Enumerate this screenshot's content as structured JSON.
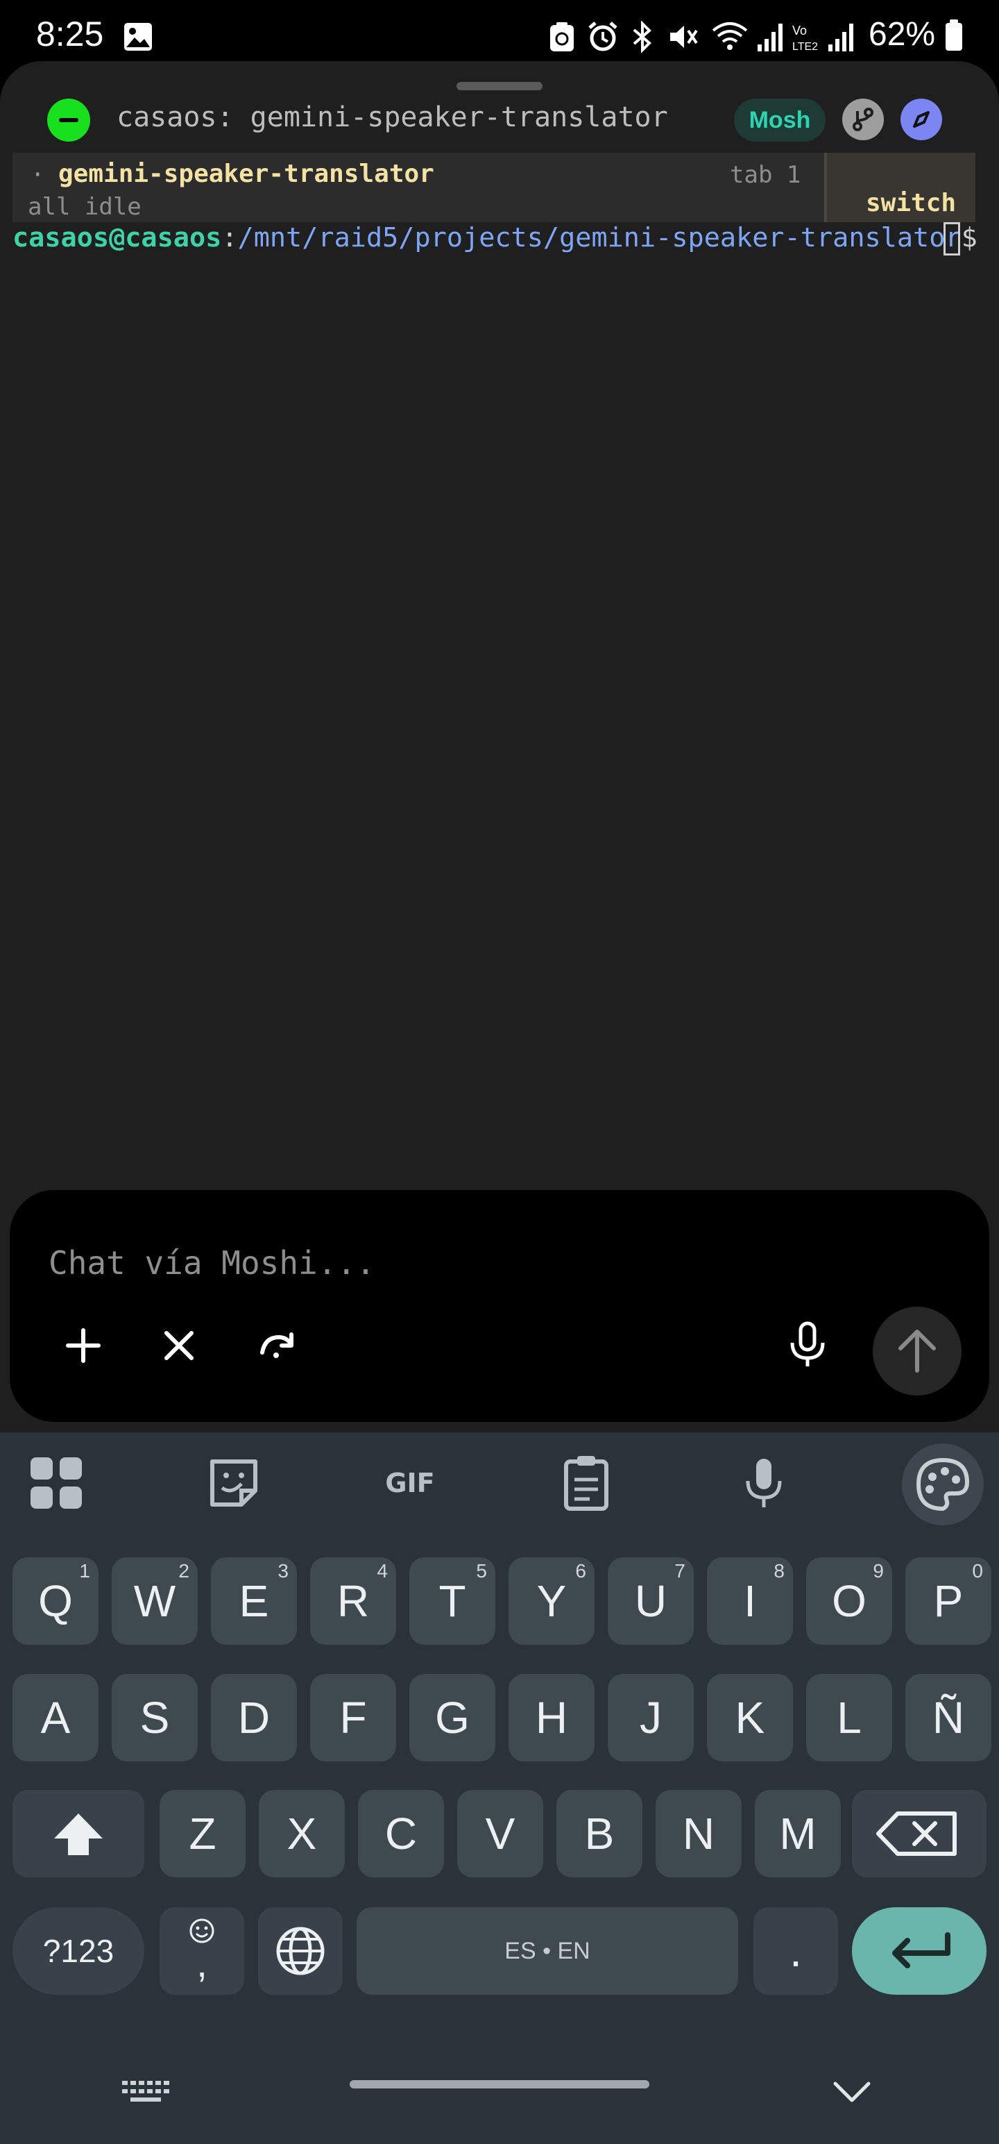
{
  "status_bar": {
    "time": "8:25",
    "battery": "62%",
    "icons": [
      "image-icon",
      "recycle-icon",
      "alarm-icon",
      "bluetooth-icon",
      "mute-icon",
      "wifi-icon",
      "signal-icon",
      "volte-icon",
      "signal-icon",
      "battery-icon"
    ]
  },
  "header": {
    "title": "casaos: gemini-speaker-translator",
    "badge": "Mosh"
  },
  "tmux": {
    "bullet": "·",
    "session_name": "gemini-speaker-translator",
    "tab": "tab 1",
    "state": "all idle",
    "switch_label": "switch"
  },
  "terminal": {
    "user_host": "casaos@casaos",
    "separator": ":",
    "path": "/mnt/raid5/projects/gemini-speaker-translator",
    "dollar": "$"
  },
  "chat": {
    "placeholder": "Chat vía Moshi...",
    "value": ""
  },
  "keyboard": {
    "toolbar": [
      "apps-grid-icon",
      "sticker-icon",
      "GIF",
      "clipboard-icon",
      "microphone-icon",
      "palette-icon"
    ],
    "row1": [
      {
        "k": "Q",
        "h": "1"
      },
      {
        "k": "W",
        "h": "2"
      },
      {
        "k": "E",
        "h": "3"
      },
      {
        "k": "R",
        "h": "4"
      },
      {
        "k": "T",
        "h": "5"
      },
      {
        "k": "Y",
        "h": "6"
      },
      {
        "k": "U",
        "h": "7"
      },
      {
        "k": "I",
        "h": "8"
      },
      {
        "k": "O",
        "h": "9"
      },
      {
        "k": "P",
        "h": "0"
      }
    ],
    "row2": [
      "A",
      "S",
      "D",
      "F",
      "G",
      "H",
      "J",
      "K",
      "L",
      "Ñ"
    ],
    "row3": [
      "Z",
      "X",
      "C",
      "V",
      "B",
      "N",
      "M"
    ],
    "symbols_label": "?123",
    "emoji_comma": ",",
    "space_label": "ES • EN",
    "period": "."
  },
  "colors": {
    "terminal_bg": "#1f1f1f",
    "connect_green": "#19e01e",
    "mosh_teal": "#2ed3b0",
    "prompt_user": "#3fd3a4",
    "prompt_path": "#7fa6f5",
    "tmux_name": "#f3e2a4",
    "keyboard_bg": "#2b333a",
    "key_bg": "#3f4950",
    "enter_bg": "#6ab6ad"
  }
}
